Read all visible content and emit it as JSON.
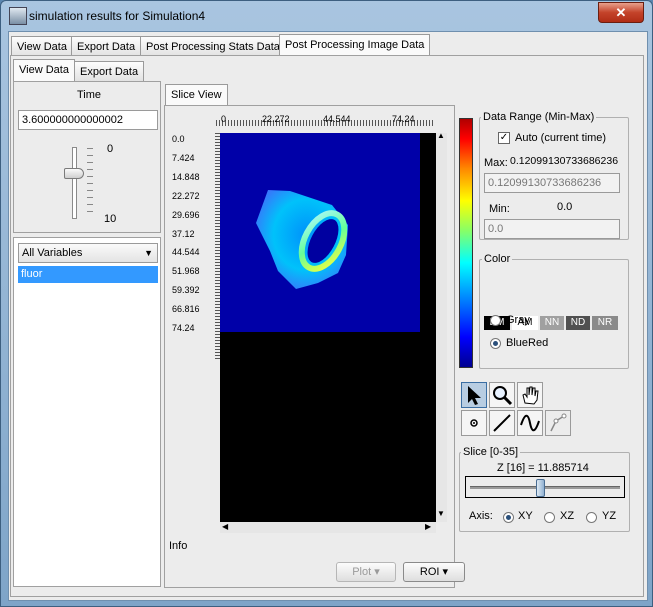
{
  "window": {
    "title": "simulation results for Simulation4",
    "close_label": "✕"
  },
  "main_tabs": [
    {
      "label": "View Data"
    },
    {
      "label": "Export Data"
    },
    {
      "label": "Post Processing Stats Data"
    },
    {
      "label": "Post Processing Image Data"
    }
  ],
  "sub_tabs": [
    {
      "label": "View Data"
    },
    {
      "label": "Export Data"
    }
  ],
  "time_panel": {
    "label": "Time",
    "value": "3.600000000000002",
    "slider_min": "0",
    "slider_max": "10",
    "slider_fraction": 0.36
  },
  "variables": {
    "dropdown_value": "All Variables",
    "items": [
      {
        "label": "fluor"
      }
    ]
  },
  "slice_view": {
    "tab_label": "Slice View",
    "x_ticks": [
      "0",
      "22.272",
      "44.544",
      "74.24"
    ],
    "y_ticks": [
      "0.0",
      "7.424",
      "14.848",
      "22.272",
      "29.696",
      "37.12",
      "44.544",
      "51.968",
      "59.392",
      "66.816",
      "74.24"
    ],
    "info_label": "Info"
  },
  "data_range": {
    "title": "Data Range (Min-Max)",
    "auto_label": "Auto (current time)",
    "auto_checked": true,
    "max_label": "Max:",
    "max_value": "0.12099130733686236",
    "max_field": "0.12099130733686236",
    "min_label": "Min:",
    "min_value": "0.0",
    "min_field": "0.0"
  },
  "color": {
    "title": "Color",
    "buttons": [
      {
        "label": "BM"
      },
      {
        "label": "AM"
      },
      {
        "label": "NN"
      },
      {
        "label": "ND"
      },
      {
        "label": "NR"
      }
    ],
    "radio_gray": "Gray",
    "radio_bluered": "BlueRed",
    "selected": "BlueRed"
  },
  "slice": {
    "title": "Slice [0-35]",
    "z_label": "Z [16] = 11.885714",
    "slider_fraction": 0.457,
    "axis_label": "Axis:",
    "axes": [
      {
        "label": "XY"
      },
      {
        "label": "XZ"
      },
      {
        "label": "YZ"
      }
    ],
    "selected_axis": "XY"
  },
  "buttons": {
    "plot_label": "Plot ▾",
    "roi_label": "ROI ▾"
  }
}
